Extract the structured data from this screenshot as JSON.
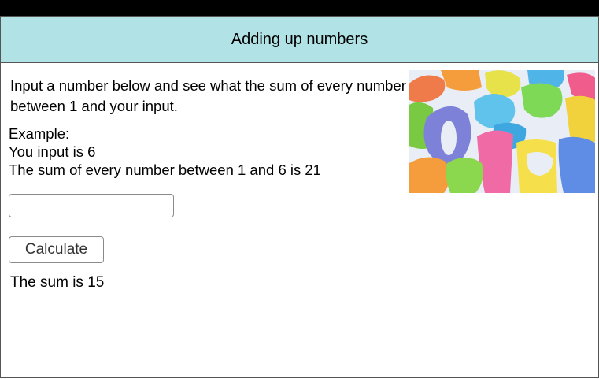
{
  "header": {
    "title": "Adding up numbers"
  },
  "intro": {
    "text": "Input a number below and see what the sum of every number between 1 and your input."
  },
  "example": {
    "heading": "Example:",
    "input_line": "You input is 6",
    "result_line": "The sum of every number between 1 and 6 is 21"
  },
  "form": {
    "number_value": "",
    "calculate_label": "Calculate"
  },
  "result": {
    "text": "The sum is 15"
  },
  "image": {
    "subject": "colorful-plastic-numbers-photo"
  },
  "colors": {
    "header_bg": "#b0e2e6",
    "top_bar": "#000000"
  }
}
